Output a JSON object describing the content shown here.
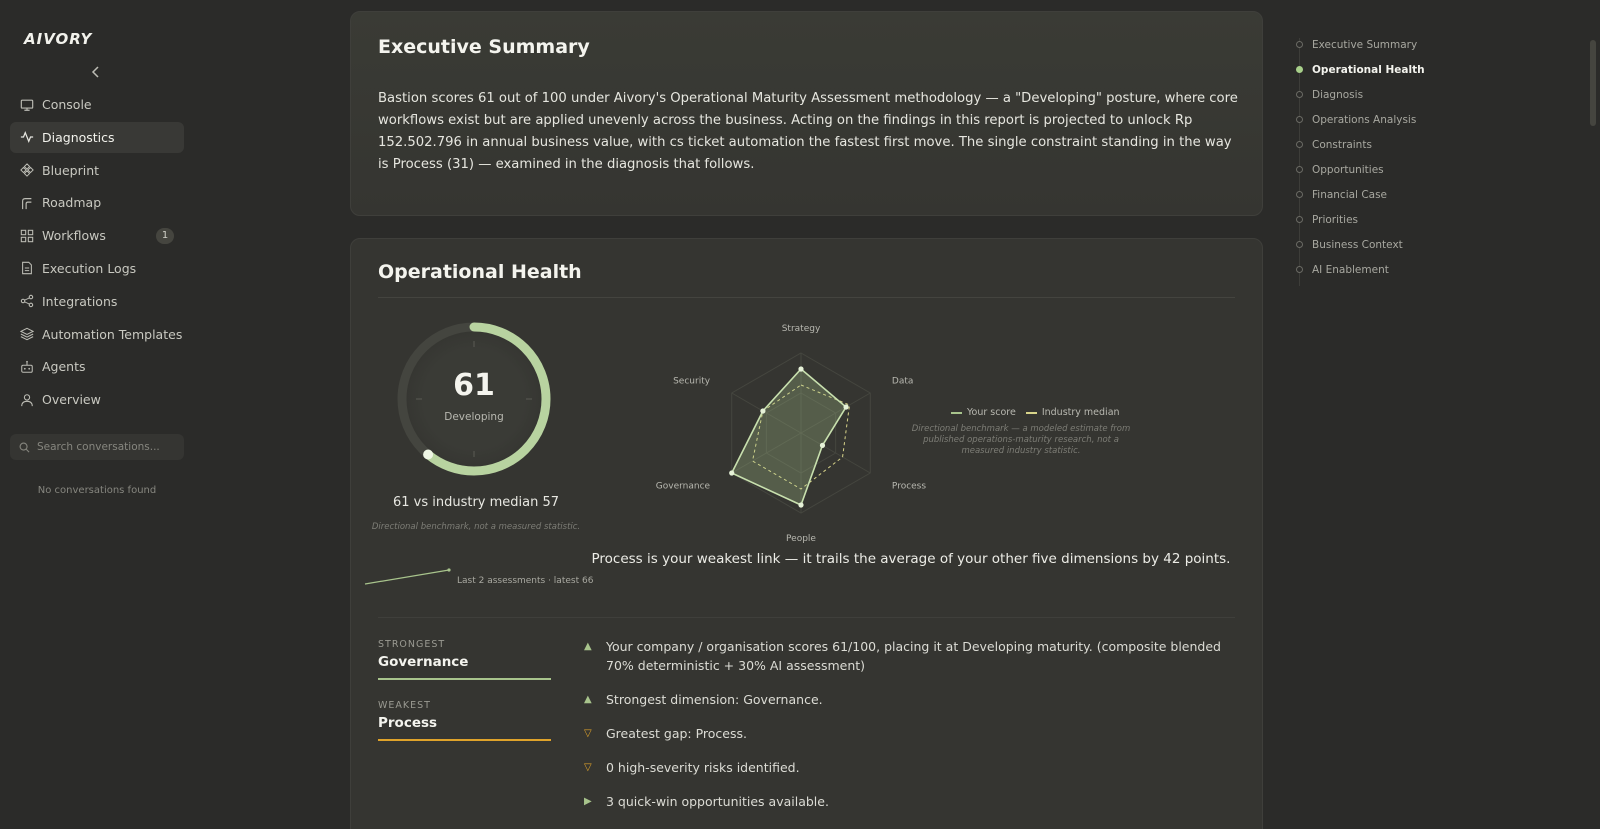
{
  "app": {
    "logo_text": "AIVORY"
  },
  "sidebar": {
    "items": [
      {
        "label": "Console",
        "icon": "monitor-icon"
      },
      {
        "label": "Diagnostics",
        "icon": "activity-icon",
        "active": true
      },
      {
        "label": "Blueprint",
        "icon": "blueprint-icon"
      },
      {
        "label": "Roadmap",
        "icon": "roadmap-icon"
      },
      {
        "label": "Workflows",
        "icon": "grid-icon",
        "badge": "1"
      },
      {
        "label": "Execution Logs",
        "icon": "document-icon"
      },
      {
        "label": "Integrations",
        "icon": "share-icon"
      },
      {
        "label": "Automation Templates",
        "icon": "layers-icon"
      },
      {
        "label": "Agents",
        "icon": "robot-icon"
      },
      {
        "label": "Overview",
        "icon": "user-icon"
      }
    ],
    "search_placeholder": "Search conversations...",
    "empty_text": "No conversations found"
  },
  "exec_summary": {
    "title": "Executive Summary",
    "body": "Bastion scores 61 out of 100 under Aivory's Operational Maturity Assessment methodology — a \"Developing\" posture, where core workflows exist but are applied unevenly across the business. Acting on the findings in this report is projected to unlock Rp 152.502.796 in annual business value, with cs ticket automation the fastest first move. The single constraint standing in the way is Process (31) — examined in the diagnosis that follows."
  },
  "health": {
    "title": "Operational Health",
    "score": "61",
    "score_max": 100,
    "score_label": "Developing",
    "median_text": "61 vs industry median 57",
    "median_note": "Directional benchmark, not a measured statistic.",
    "trend_label": "Last 2 assessments · latest 66",
    "weakest_text": "Process is your weakest link — it trails the average of your other five dimensions by 42 points.",
    "strongest_label": "STRONGEST",
    "strongest_value": "Governance",
    "weakest_label": "WEAKEST",
    "weakest_value": "Process",
    "findings": [
      {
        "text": "Your company / organisation scores 61/100, placing it at Developing maturity. (composite blended 70% deterministic + 30% AI assessment)",
        "type": "up"
      },
      {
        "text": "Strongest dimension: Governance.",
        "type": "up"
      },
      {
        "text": "Greatest gap: Process.",
        "type": "down"
      },
      {
        "text": "0 high-severity risks identified.",
        "type": "down"
      },
      {
        "text": "3 quick-win opportunities available.",
        "type": "right"
      }
    ],
    "colors": {
      "accent": "#a8c48c",
      "strong_bar": "#a8c48c",
      "weak_bar": "#e0a32a",
      "down_mark": "#e0a32a"
    }
  },
  "chart_data": {
    "type": "radar",
    "categories": [
      "Strategy",
      "Data",
      "Process",
      "People",
      "Governance",
      "Security"
    ],
    "series": [
      {
        "name": "Your score",
        "values": [
          80,
          65,
          31,
          90,
          100,
          55
        ]
      },
      {
        "name": "Industry median",
        "values": [
          60,
          70,
          60,
          70,
          70,
          55
        ]
      }
    ],
    "rlim": [
      0,
      100
    ],
    "legend": "right",
    "note": "Directional benchmark — a modeled estimate from published operations-maturity research, not a measured industry statistic."
  },
  "toc": {
    "items": [
      {
        "label": "Executive Summary"
      },
      {
        "label": "Operational Health",
        "active": true
      },
      {
        "label": "Diagnosis"
      },
      {
        "label": "Operations Analysis"
      },
      {
        "label": "Constraints"
      },
      {
        "label": "Opportunities"
      },
      {
        "label": "Financial Case"
      },
      {
        "label": "Priorities"
      },
      {
        "label": "Business Context"
      },
      {
        "label": "AI Enablement"
      }
    ]
  }
}
